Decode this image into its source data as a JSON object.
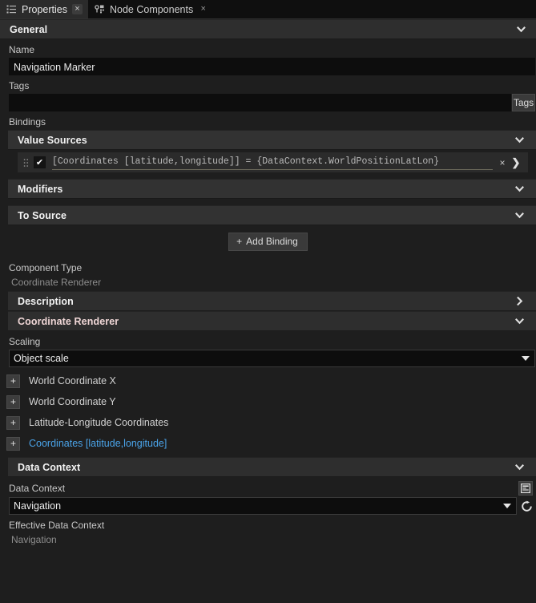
{
  "tabs": [
    {
      "label": "Properties",
      "icon": "list-icon",
      "active": true,
      "close": "×"
    },
    {
      "label": "Node Components",
      "icon": "node-graph-icon",
      "active": false,
      "close": "×"
    }
  ],
  "sections": {
    "general": "General",
    "value_sources": "Value Sources",
    "modifiers": "Modifiers",
    "to_source": "To Source",
    "description": "Description",
    "coordinate_renderer": "Coordinate Renderer",
    "data_context": "Data Context"
  },
  "general": {
    "name_label": "Name",
    "name_value": "Navigation Marker",
    "name_placeholder": "",
    "tags_label": "Tags",
    "tags_value": "",
    "tags_placeholder": "",
    "tags_button": "Tags",
    "bindings_label": "Bindings"
  },
  "binding": {
    "grip": "⁙",
    "checked": "✔",
    "expression": "[Coordinates [latitude,longitude]] = {DataContext.WorldPositionLatLon}",
    "remove": "×",
    "go": "❯"
  },
  "add_binding": {
    "plus": "+",
    "label": "Add Binding"
  },
  "component": {
    "type_label": "Component Type",
    "type_value": "Coordinate Renderer"
  },
  "renderer": {
    "scaling_label": "Scaling",
    "scaling_value": "Object scale",
    "properties": [
      {
        "label": "World Coordinate X",
        "expand": "+",
        "linked": false
      },
      {
        "label": "World Coordinate Y",
        "expand": "+",
        "linked": false
      },
      {
        "label": "Latitude-Longitude Coordinates",
        "expand": "+",
        "linked": false
      },
      {
        "label": "Coordinates [latitude,longitude]",
        "expand": "+",
        "linked": true
      }
    ]
  },
  "data_context": {
    "field_label": "Data Context",
    "value": "Navigation",
    "effective_label": "Effective Data Context",
    "effective_value": "Navigation"
  },
  "colors": {
    "accent_link": "#4aa3e8",
    "panel_bg": "#1e1e1e",
    "section_bg": "#2e2e2e",
    "input_bg": "#0d0d0d",
    "underline": "#6d6a5c"
  },
  "chevrons": {
    "down": "⌄",
    "right": "›"
  }
}
